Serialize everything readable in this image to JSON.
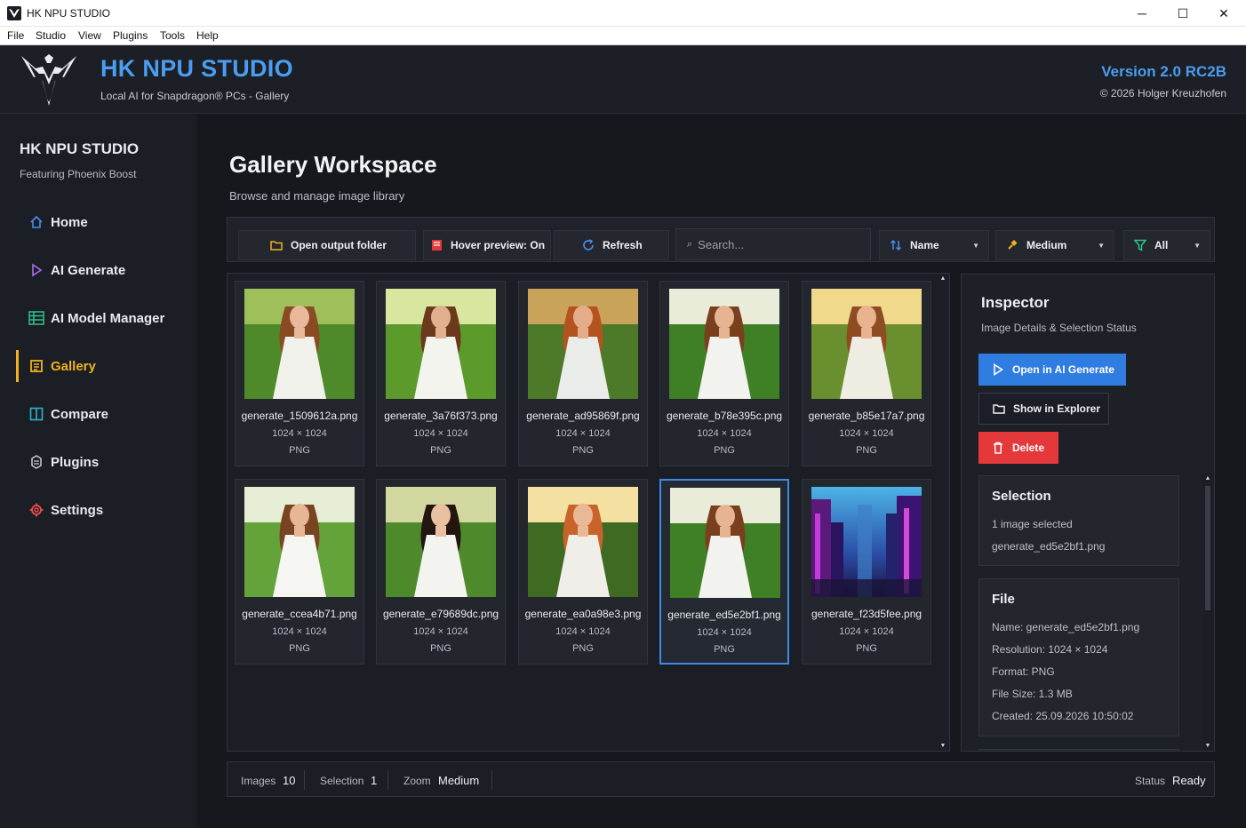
{
  "window": {
    "title": "HK NPU STUDIO",
    "menu": [
      "File",
      "Studio",
      "View",
      "Plugins",
      "Tools",
      "Help"
    ],
    "controls": {
      "minimize": "─",
      "maximize": "☐",
      "close": "✕"
    }
  },
  "banner": {
    "brand": "HK NPU STUDIO",
    "tagline": "Local AI for Snapdragon® PCs - Gallery",
    "version": "Version 2.0 RC2B",
    "copyright": "© 2026 Holger Kreuzhofen"
  },
  "sidebar": {
    "title": "HK NPU STUDIO",
    "subtitle": "Featuring Phoenix Boost",
    "items": [
      {
        "label": "Home",
        "icon": "home-icon",
        "color": "#4a8ef0"
      },
      {
        "label": "AI Generate",
        "icon": "play-icon",
        "color": "#a86cf5"
      },
      {
        "label": "AI Model Manager",
        "icon": "model-list-icon",
        "color": "#2fc48d"
      },
      {
        "label": "Gallery",
        "icon": "gallery-icon",
        "color": "#f0b21e",
        "active": true
      },
      {
        "label": "Compare",
        "icon": "compare-icon",
        "color": "#2bb6c8"
      },
      {
        "label": "Plugins",
        "icon": "plugin-icon",
        "color": "#c8ccd3"
      },
      {
        "label": "Settings",
        "icon": "gear-icon",
        "color": "#ee4d4d"
      }
    ]
  },
  "main": {
    "title": "Gallery Workspace",
    "subtitle": "Browse and manage image library"
  },
  "toolbar": {
    "open_folder": "Open output folder",
    "hover_preview": "Hover preview: On",
    "refresh": "Refresh",
    "search_placeholder": "Search...",
    "sort": "Name",
    "zoom": "Medium",
    "filter": "All"
  },
  "gallery": {
    "images": [
      {
        "name": "generate_1509612a.png",
        "resolution": "1024 × 1024",
        "format": "PNG",
        "palette": "meadow-soft"
      },
      {
        "name": "generate_3a76f373.png",
        "resolution": "1024 × 1024",
        "format": "PNG",
        "palette": "meadow-bright"
      },
      {
        "name": "generate_ad95869f.png",
        "resolution": "1024 × 1024",
        "format": "PNG",
        "palette": "meadow-sunset"
      },
      {
        "name": "generate_b78e395c.png",
        "resolution": "1024 × 1024",
        "format": "PNG",
        "palette": "meadow-sky"
      },
      {
        "name": "generate_b85e17a7.png",
        "resolution": "1024 × 1024",
        "format": "PNG",
        "palette": "meadow-golden"
      },
      {
        "name": "generate_ccea4b71.png",
        "resolution": "1024 × 1024",
        "format": "PNG",
        "palette": "meadow-light"
      },
      {
        "name": "generate_e79689dc.png",
        "resolution": "1024 × 1024",
        "format": "PNG",
        "palette": "meadow-dark"
      },
      {
        "name": "generate_ea0a98e3.png",
        "resolution": "1024 × 1024",
        "format": "PNG",
        "palette": "meadow-glow"
      },
      {
        "name": "generate_ed5e2bf1.png",
        "resolution": "1024 × 1024",
        "format": "PNG",
        "palette": "meadow-sky",
        "selected": true
      },
      {
        "name": "generate_f23d5fee.png",
        "resolution": "1024 × 1024",
        "format": "PNG",
        "palette": "city-neon"
      }
    ]
  },
  "inspector": {
    "title": "Inspector",
    "subtitle": "Image Details & Selection Status",
    "open_ai": "Open in AI Generate",
    "show_explorer": "Show in Explorer",
    "delete": "Delete",
    "selection": {
      "title": "Selection",
      "count": "1 image selected",
      "file": "generate_ed5e2bf1.png"
    },
    "file": {
      "title": "File",
      "name": "Name: generate_ed5e2bf1.png",
      "resolution": "Resolution: 1024 × 1024",
      "format": "Format: PNG",
      "size": "File Size: 1.3 MB",
      "created": "Created: 25.09.2026 10:50:02"
    }
  },
  "statusbar": {
    "images_label": "Images",
    "images_value": "10",
    "selection_label": "Selection",
    "selection_value": "1",
    "zoom_label": "Zoom",
    "zoom_value": "Medium",
    "status_label": "Status",
    "status_value": "Ready"
  },
  "colors": {
    "accent": "#4a9df0",
    "active_nav": "#f0b21e",
    "primary_button": "#2f7de1",
    "danger_button": "#e5383b",
    "selection_border": "#3b8bea"
  }
}
